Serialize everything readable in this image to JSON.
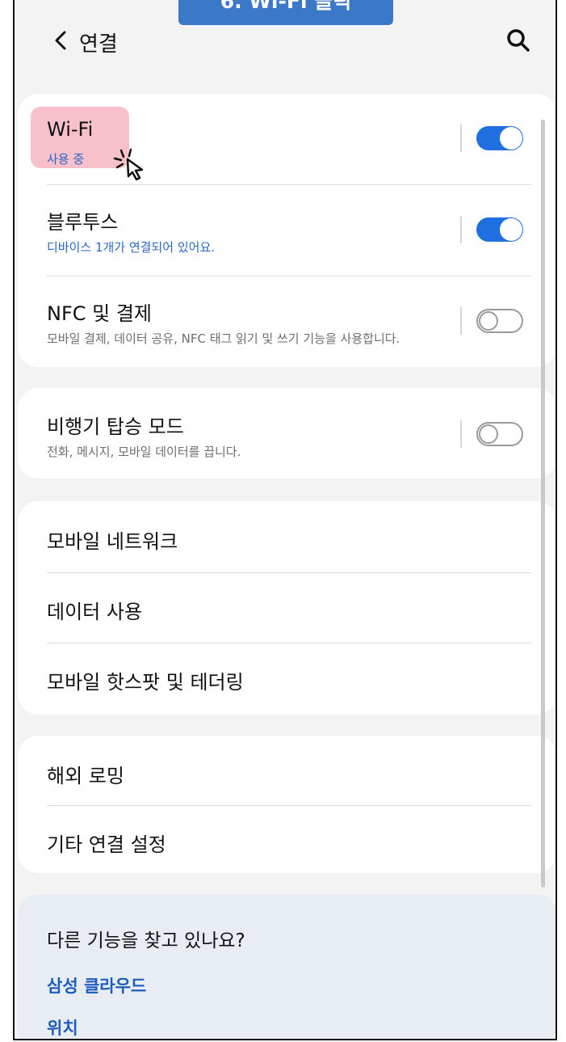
{
  "banner": {
    "text": "6. Wi-Fi 클릭"
  },
  "header": {
    "title": "연결"
  },
  "group1": {
    "wifi": {
      "title": "Wi-Fi",
      "subtitle": "사용 중",
      "toggle": "on"
    },
    "bluetooth": {
      "title": "블루투스",
      "subtitle": "디바이스 1개가 연결되어 있어요.",
      "toggle": "on"
    },
    "nfc": {
      "title": "NFC 및 결제",
      "subtitle": "모바일 결제, 데이터 공유, NFC 태그 읽기 및 쓰기 기능을 사용합니다.",
      "toggle": "off"
    }
  },
  "group2": {
    "airplane": {
      "title": "비행기 탑승 모드",
      "subtitle": "전화, 메시지, 모바일 데이터를 끕니다.",
      "toggle": "off"
    }
  },
  "group3": {
    "items": [
      {
        "label": "모바일 네트워크"
      },
      {
        "label": "데이터 사용"
      },
      {
        "label": "모바일 핫스팟 및 테더링"
      }
    ]
  },
  "group4": {
    "items": [
      {
        "label": "해외 로밍"
      },
      {
        "label": "기타 연결 설정"
      }
    ]
  },
  "suggest": {
    "title": "다른 기능을 찾고 있나요?",
    "links": [
      "삼성 클라우드",
      "위치"
    ]
  },
  "colors": {
    "accent": "#1f6fe0",
    "link": "#1e5cbe",
    "banner": "#3b78c8",
    "highlight": "#f08ca0"
  }
}
